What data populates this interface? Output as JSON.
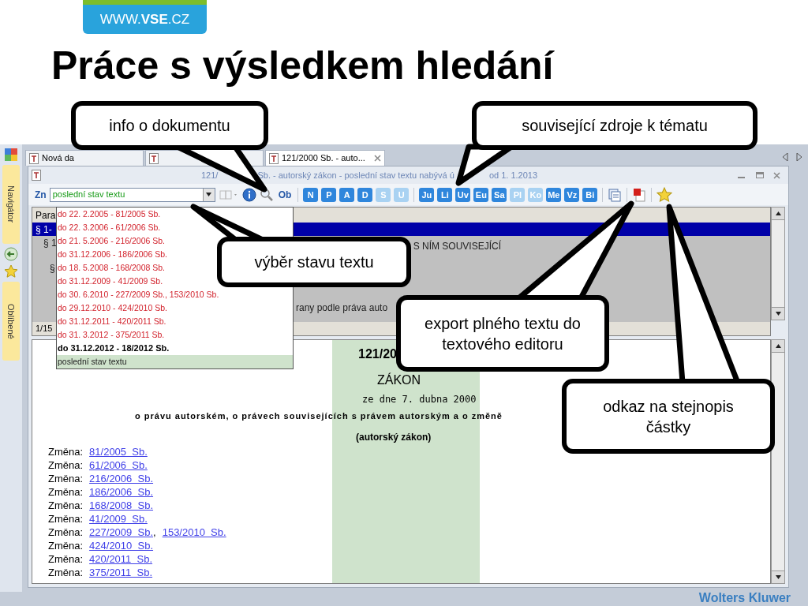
{
  "slide": {
    "logo": "WWW.**VSE**.CZ",
    "title": "Práce s výsledkem hledání",
    "footer_logo": "Wolters Kluwer"
  },
  "rail": [
    {
      "kind": "tab",
      "label": "Navigátor"
    },
    {
      "kind": "tab",
      "label": "Oblíbené"
    }
  ],
  "tabs": [
    {
      "label": "Nová da",
      "selected": false
    },
    {
      "selected": false
    },
    {
      "label": "121/2000 Sb. - auto...",
      "selected": true
    }
  ],
  "window": {
    "title_parts": [
      "121/",
      "Sb. - autorský zákon - poslední stav textu nabývá ú",
      "od  1. 1.2013"
    ]
  },
  "toolbar": {
    "zn": "Zn",
    "state_select": "poslední stav textu",
    "ob": "Ob",
    "letters": [
      {
        "label": "N",
        "disabled": false
      },
      {
        "label": "P",
        "disabled": false
      },
      {
        "label": "A",
        "disabled": false
      },
      {
        "label": "D",
        "disabled": false
      },
      {
        "label": "S",
        "disabled": true
      },
      {
        "label": "U",
        "disabled": true
      }
    ],
    "sources": [
      {
        "label": "Ju",
        "disabled": false
      },
      {
        "label": "Li",
        "disabled": false
      },
      {
        "label": "Uv",
        "disabled": false
      },
      {
        "label": "Eu",
        "disabled": false
      },
      {
        "label": "Sa",
        "disabled": false
      },
      {
        "label": "Pl",
        "disabled": true
      },
      {
        "label": "Ko",
        "disabled": true
      },
      {
        "label": "Me",
        "disabled": false
      },
      {
        "label": "Vz",
        "disabled": false
      },
      {
        "label": "Bi",
        "disabled": false
      }
    ]
  },
  "dropdown": [
    {
      "label": "do 22. 2.2005 -  81/2005 Sb.",
      "kind": "past",
      "selected": false
    },
    {
      "label": "do 22. 3.2006 -  61/2006 Sb.",
      "kind": "past",
      "selected": false
    },
    {
      "label": "do 21. 5.2006 -  216/2006 Sb.",
      "kind": "past",
      "selected": false
    },
    {
      "label": "do 31.12.2006 -  186/2006 Sb.",
      "kind": "past",
      "selected": false
    },
    {
      "label": "do 18. 5.2008 -  168/2008 Sb.",
      "kind": "past",
      "selected": false
    },
    {
      "label": "do 31.12.2009 -  41/2009 Sb.",
      "kind": "past",
      "selected": false
    },
    {
      "label": "do 30. 6.2010 -  227/2009 Sb., 153/2010 Sb.",
      "kind": "past",
      "selected": false
    },
    {
      "label": "do 29.12.2010 -  424/2010 Sb.",
      "kind": "past",
      "selected": false
    },
    {
      "label": "do 31.12.2011 -  420/2011 Sb.",
      "kind": "past",
      "selected": false
    },
    {
      "label": "do 31. 3.2012 -  375/2011 Sb.",
      "kind": "past",
      "selected": false
    },
    {
      "label": "do 31.12.2012 -  18/2012 Sb.",
      "kind": "current",
      "selected": false
    },
    {
      "label": "poslední stav textu",
      "kind": "latest",
      "selected": true
    }
  ],
  "outline": {
    "header": "Para",
    "rows": [
      {
        "left": "§ 1-",
        "right": "",
        "selected": true
      },
      {
        "left": "§ 1",
        "right": "S NÍM SOUVISEJÍCÍ",
        "selected": false
      },
      {
        "left": "§",
        "right": "",
        "selected": false
      },
      {
        "left": "",
        "right": "rany podle práva auto",
        "selected": false
      }
    ],
    "status": "1/15"
  },
  "document": {
    "number": "121/20",
    "kind_title": "ZÁKON",
    "date": "ze dne 7. dubna 2000",
    "subject": "o právu autorském, o právech souvisejících s právem autorským a o změně",
    "short_title": "(autorský zákon)",
    "changes": [
      {
        "label": "Změna:",
        "links": [
          "81/2005  Sb."
        ]
      },
      {
        "label": "Změna:",
        "links": [
          "61/2006  Sb."
        ]
      },
      {
        "label": "Změna:",
        "links": [
          "216/2006  Sb."
        ]
      },
      {
        "label": "Změna:",
        "links": [
          "186/2006  Sb."
        ]
      },
      {
        "label": "Změna:",
        "links": [
          "168/2008  Sb."
        ]
      },
      {
        "label": "Změna:",
        "links": [
          "41/2009  Sb."
        ]
      },
      {
        "label": "Změna:",
        "links": [
          "227/2009  Sb.",
          "153/2010  Sb."
        ],
        "separator": ","
      },
      {
        "label": "Změna:",
        "links": [
          "424/2010  Sb."
        ]
      },
      {
        "label": "Změna:",
        "links": [
          "420/2011  Sb."
        ]
      },
      {
        "label": "Změna:",
        "links": [
          "375/2011  Sb."
        ]
      }
    ]
  },
  "callouts": [
    "info o dokumentu",
    "související zdroje k tématu",
    "výběr stavu textu",
    "export plného textu do textového editoru",
    "odkaz na stejnopis částky"
  ]
}
